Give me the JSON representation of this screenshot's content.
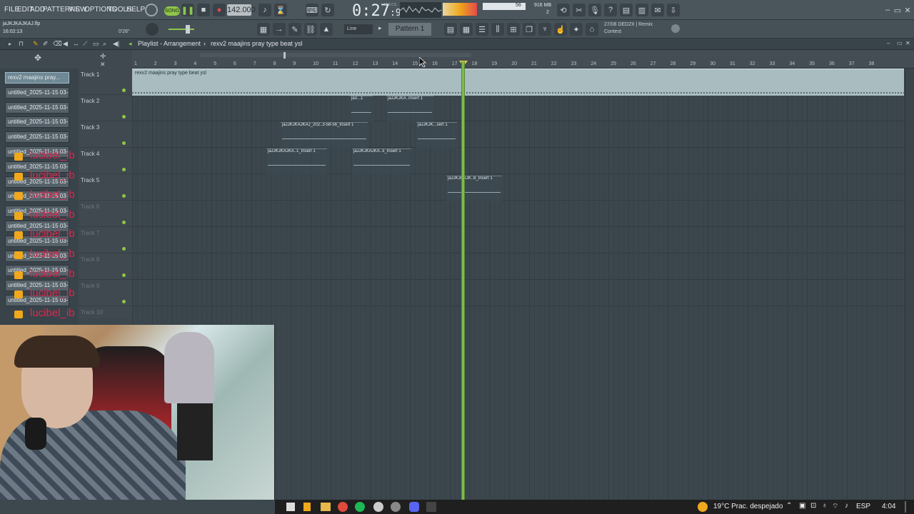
{
  "menu": [
    "FILE",
    "EDIT",
    "ADD",
    "PATTERNS",
    "VIEW",
    "OPTIONS",
    "TOOLS",
    "HELP"
  ],
  "transport": {
    "song_label": "SONG",
    "tempo": "142.000",
    "time_main": "0:27",
    "time_sub": "99",
    "time_unit": "M:S:CS"
  },
  "perf": {
    "mem": "916 MB",
    "cpu_val": "56",
    "poly": "2"
  },
  "project": {
    "file": "jaJKJKAJKAJ.flp",
    "clock": "16:02:13",
    "position": "0'26\""
  },
  "subbar": {
    "snap": "Line",
    "pattern": "Pattern 1"
  },
  "hint": {
    "line1": "27/08  DEDZII | Remix",
    "line2": "Contest"
  },
  "playlist": {
    "title": "Playlist - Arrangement",
    "breadcrumb": "rexv2  maajins  pray type beat ysl"
  },
  "ruler": [
    "1",
    "2",
    "3",
    "4",
    "5",
    "6",
    "7",
    "8",
    "9",
    "10",
    "11",
    "12",
    "13",
    "14",
    "15",
    "16",
    "17",
    "18",
    "19",
    "20",
    "21",
    "22",
    "23",
    "24",
    "25",
    "26",
    "27",
    "28",
    "29",
    "30",
    "31",
    "32",
    "33",
    "34",
    "35",
    "36",
    "37",
    "38"
  ],
  "picker": [
    "rexv2  maajins  pray...",
    "untitled_2025-11-15 03-...",
    "untitled_2025-11-15 03-...",
    "untitled_2025-11-15 03-...",
    "untitled_2025-11-15 03-...",
    "untitled_2025-11-15 03-...",
    "untitled_2025-11-15 03-...",
    "untitled_2025-11-15 03-...",
    "untitled_2025-11-15 03-...",
    "untitled_2025-11-15 03-...",
    "untitled_2025-11-15 03-...",
    "untitled_2025-11-15 03-...",
    "untitled_2025-11-15 03-...",
    "untitled_2025-11-15 03-...",
    "untitled_2025-11-15 03-...",
    "untitled_2025-11-15 03-..."
  ],
  "overlay_text": "lucibel_ib",
  "tracks": [
    "Track 1",
    "Track 2",
    "Track 3",
    "Track 4",
    "Track 5",
    "Track 6",
    "Track 7",
    "Track 8",
    "Track 9",
    "Track 10"
  ],
  "audio_clip": "rexv2  maajins  pray type beat ysl",
  "clips": {
    "c1": "ja3...1",
    "c2": "jaJJKJKA..Insert 1",
    "c3": "jaJJKJKAJKAJ_202..3-58-56_Insert 1",
    "c4": "jaJJKJK...sert 1",
    "c5": "jaJJKJKAJKA..1_Insert 1",
    "c6": "jaJJKJKAJKA..3_Insert 1",
    "c7": "jaJJKJKAJK..8_Insert 1"
  },
  "taskbar": {
    "weather": "19°C  Prac. despejado",
    "lang": "ESP",
    "clock": "4:04"
  },
  "colors": {
    "playhead": "#8fd25a",
    "accent": "#f0a81c",
    "overlay": "#e0264f"
  }
}
